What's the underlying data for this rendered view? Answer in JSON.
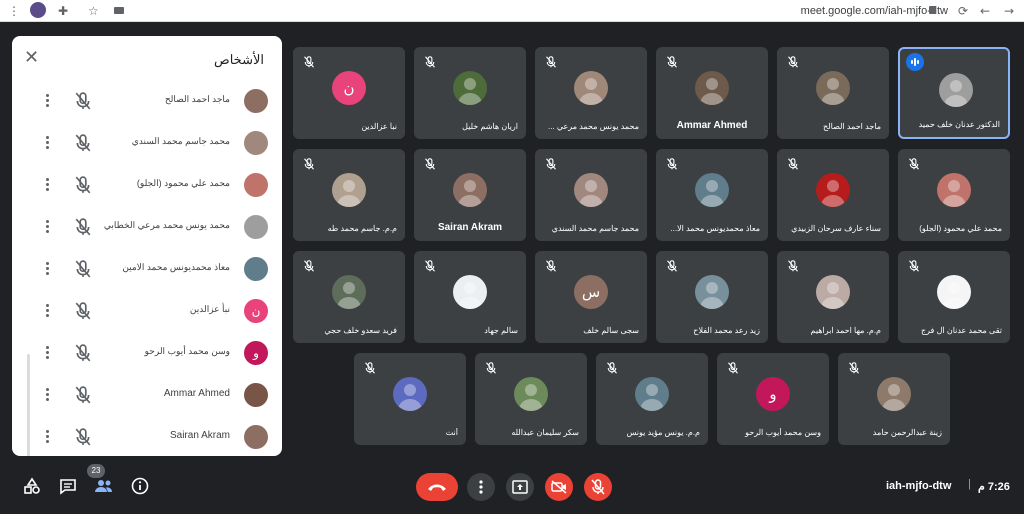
{
  "browser": {
    "url": "meet.google.com/iah-mjfo-dtw"
  },
  "panel": {
    "title": "الأشخاص",
    "participants": [
      {
        "name": "ماجد احمد الصالح",
        "avatar_color": "#8d6e63"
      },
      {
        "name": "محمد جاسم محمد السندي",
        "avatar_color": "#a1887f"
      },
      {
        "name": "محمد علي محمود (الجلو)",
        "avatar_color": "#c0736a"
      },
      {
        "name": "محمد يونس محمد مرعي الخطابي",
        "avatar_color": "#9e9e9e"
      },
      {
        "name": "معاذ محمديونس محمد الامين",
        "avatar_color": "#607d8b"
      },
      {
        "name": "نبأ عزالدين",
        "avatar_color": "#e8437a",
        "letter": "ن"
      },
      {
        "name": "وسن محمد أيوب الرحو",
        "avatar_color": "#c2185b",
        "letter": "و"
      },
      {
        "name": "Ammar Ahmed",
        "avatar_color": "#795548"
      },
      {
        "name": "Sairan Akram",
        "avatar_color": "#8d6e63"
      }
    ]
  },
  "tiles": [
    {
      "name": "نبأ عزالدين",
      "color": "#e8437a",
      "letter": "ن"
    },
    {
      "name": "اريان هاشم خليل",
      "color": "#4e6b3a"
    },
    {
      "name": "محمد يونس محمد مرعي ...",
      "color": "#a08878"
    },
    {
      "name": "Ammar Ahmed",
      "color": "#6d5a4a",
      "latin": true
    },
    {
      "name": "ماجد احمد الصالح",
      "color": "#7a6a5a"
    },
    {
      "name": "الدكتور عدنان خلف حميد",
      "color": "#9e9e9e",
      "speaking": true
    },
    {
      "name": "م.م. جاسم محمد طه",
      "color": "#b0a090"
    },
    {
      "name": "Sairan Akram",
      "color": "#8d6e63",
      "latin": true
    },
    {
      "name": "محمد جاسم محمد السندي",
      "color": "#a1887f"
    },
    {
      "name": "معاذ محمديونس محمد الا...",
      "color": "#607d8b"
    },
    {
      "name": "سناء عارف سرحان الزبيدي",
      "color": "#b71c1c"
    },
    {
      "name": "محمد علي محمود (الجلو)",
      "color": "#c0736a"
    },
    {
      "name": "فريد سعدو خلف حجي",
      "color": "#5d6d5a"
    },
    {
      "name": "سالم جهاد",
      "color": "#eceff1"
    },
    {
      "name": "سجى سالم خلف",
      "color": "#8d6e63",
      "letter": "س"
    },
    {
      "name": "زيد رعد محمد الفلاح",
      "color": "#78909c"
    },
    {
      "name": "م.م. مها احمد ابراهيم",
      "color": "#bcaaa4"
    },
    {
      "name": "تقى محمد عدنان آل فرج",
      "color": "#f5f5f5"
    },
    {
      "name": "أنت",
      "color": "#5c6bc0"
    },
    {
      "name": "سكر سليمان عبدالله",
      "color": "#6d8a5a"
    },
    {
      "name": "م.م. يونس مؤيد يونس",
      "color": "#607d8b"
    },
    {
      "name": "وسن محمد أيوب الرحو",
      "color": "#c2185b",
      "letter": "و"
    },
    {
      "name": "زينة عبدالرحمن حامد",
      "color": "#8d7a6a"
    }
  ],
  "bottom": {
    "people_count": "23",
    "meeting_code": "iah-mjfo-dtw",
    "time": "7:26 م",
    "end_call_color": "#ea4335"
  },
  "icons": {
    "browser": [
      "menu-dots-icon",
      "profile-icon",
      "extension-icon",
      "star-icon",
      "cast-icon",
      "lock-icon",
      "reload-icon",
      "back-icon",
      "forward-icon"
    ],
    "bottom": [
      "activities-icon",
      "chat-icon",
      "people-icon",
      "info-icon",
      "end-call-icon",
      "more-options-icon",
      "present-icon",
      "camera-off-icon",
      "mic-off-icon"
    ]
  }
}
